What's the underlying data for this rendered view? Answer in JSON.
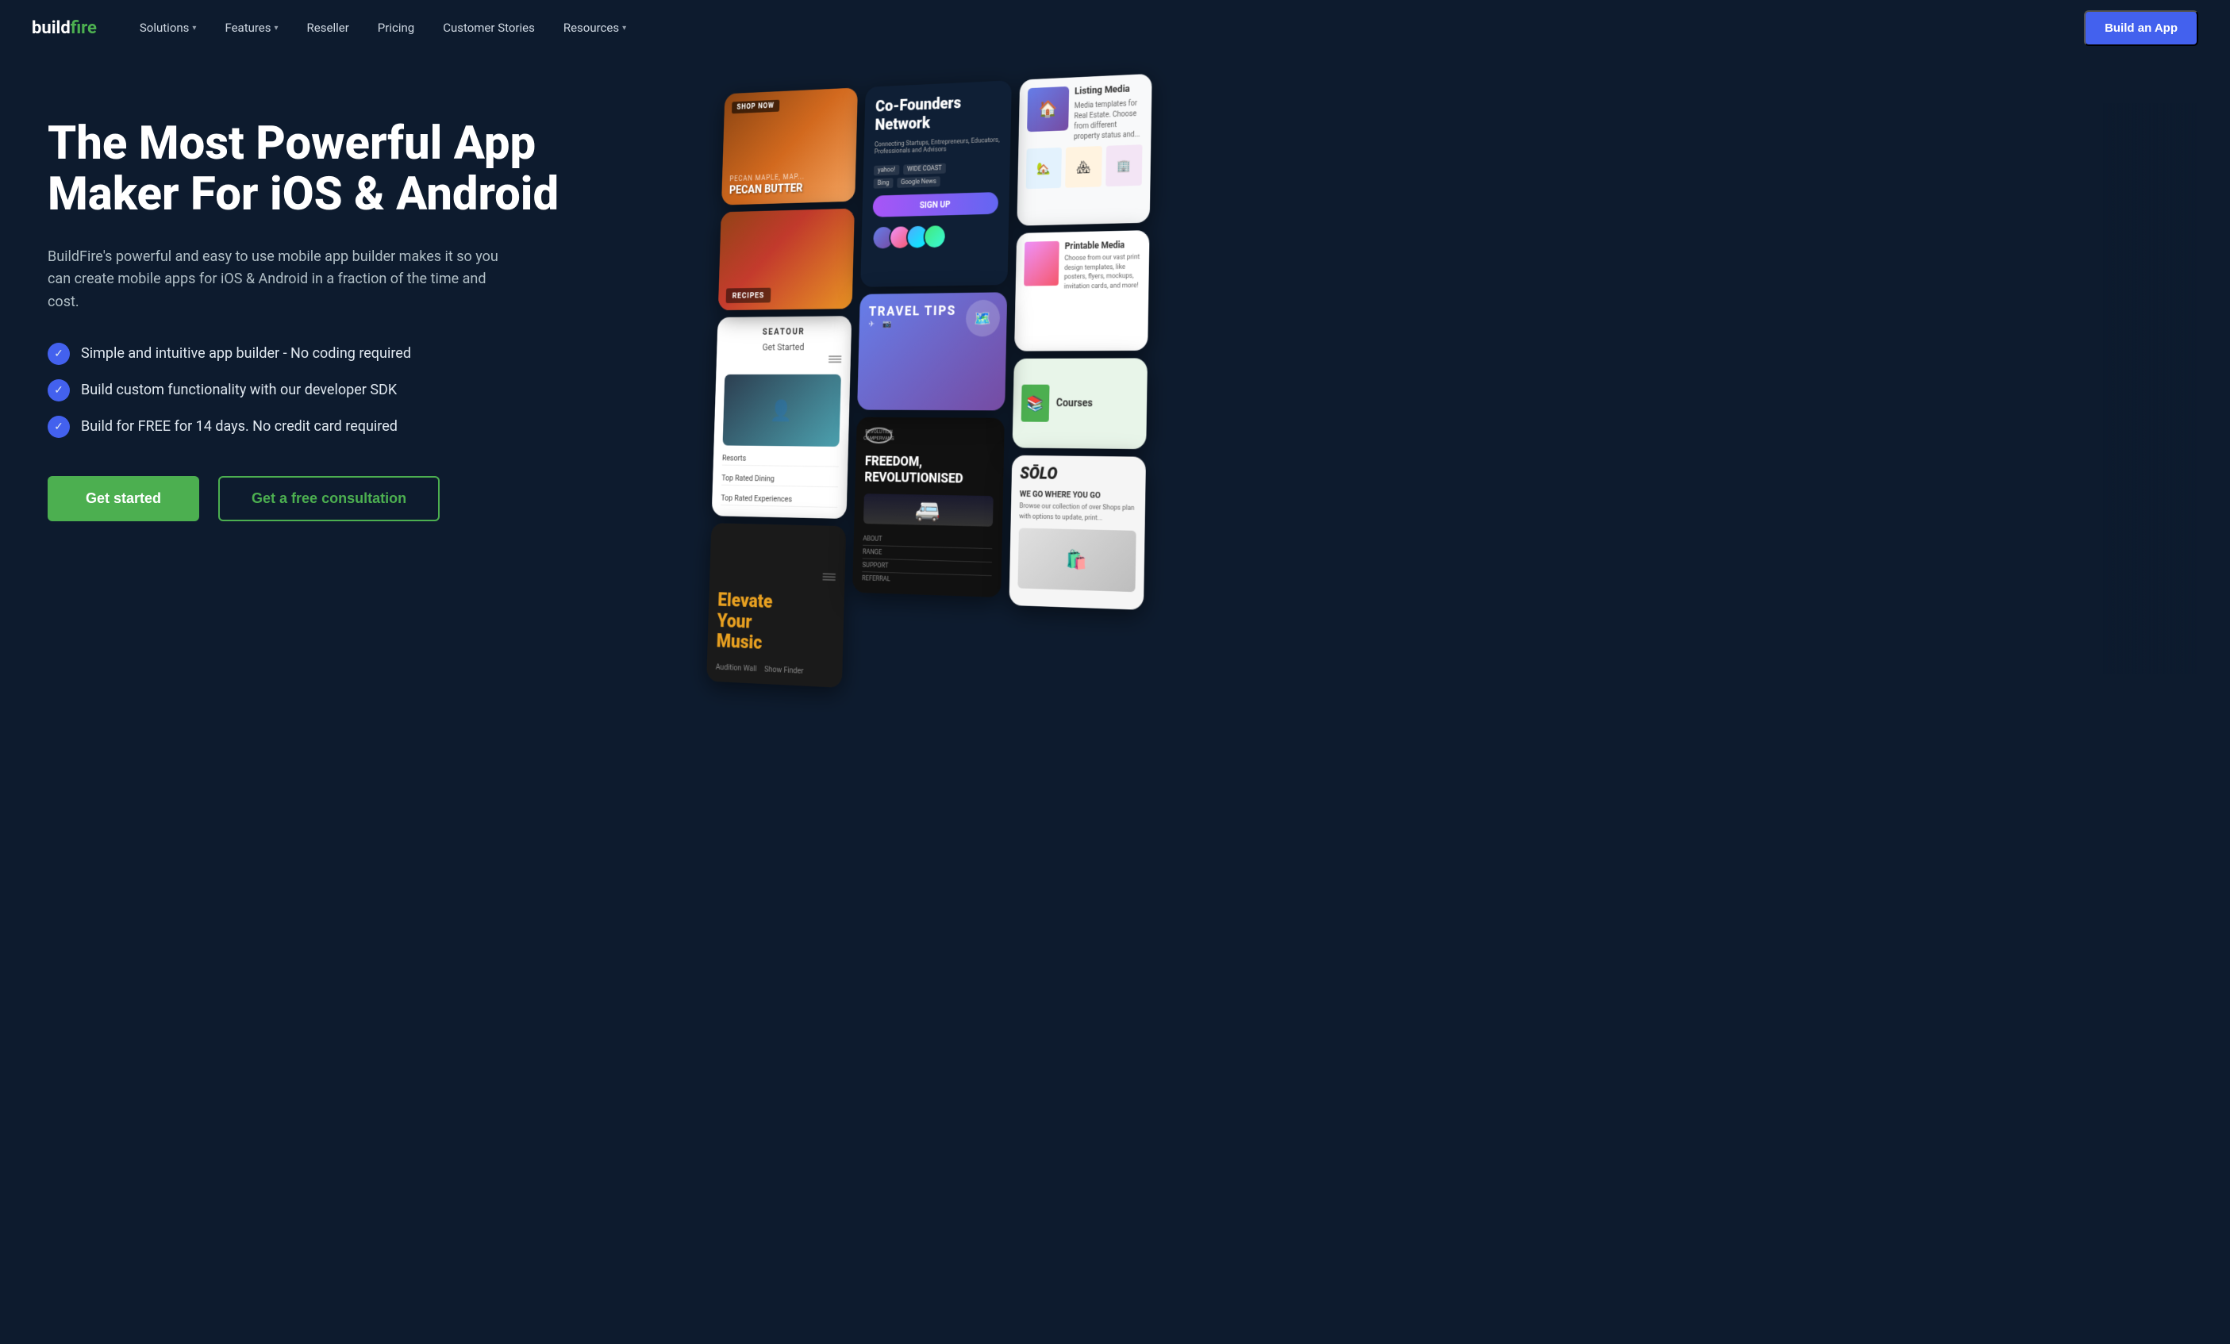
{
  "nav": {
    "logo_text": "buildfire",
    "items": [
      {
        "label": "Solutions",
        "has_dropdown": true
      },
      {
        "label": "Features",
        "has_dropdown": true
      },
      {
        "label": "Reseller",
        "has_dropdown": false
      },
      {
        "label": "Pricing",
        "has_dropdown": false
      },
      {
        "label": "Customer Stories",
        "has_dropdown": false
      },
      {
        "label": "Resources",
        "has_dropdown": true
      }
    ],
    "cta_label": "Build an App"
  },
  "hero": {
    "title": "The Most Powerful App Maker For iOS & Android",
    "subtitle": "BuildFire's powerful and easy to use mobile app builder makes it so you can create mobile apps for iOS & Android in a fraction of the time and cost.",
    "checklist": [
      "Simple and intuitive app builder - No coding required",
      "Build custom functionality with our developer SDK",
      "Build for FREE for 14 days. No credit card required"
    ],
    "btn_primary": "Get started",
    "btn_outline": "Get a free consultation"
  },
  "phones": {
    "col1": {
      "card1_label": "SHOP NOW",
      "card1_product": "PECAN BUTTER",
      "card2_label": "RECIPES",
      "seatour_brand": "SEATOUR",
      "seatour_cta": "Get Started",
      "seatour_resorts": "Resorts",
      "seatour_dining": "Top Rated Dining",
      "seatour_experiences": "Top Rated Experiences",
      "music_line1": "Elevate",
      "music_line2": "Your",
      "music_line3": "Music",
      "music_sub1": "Audition Wall",
      "music_sub2": "Show Finder"
    },
    "col2": {
      "cf_title": "Co-Founders Network",
      "cf_sub": "Connecting Startups, Entrepreneurs, Educators, Professionals and Advisors",
      "signup_label": "SIGN UP",
      "travel_title": "TRAVEL TIPS",
      "rev_badge": "REVOLUTION CAMPERVANS",
      "rev_title": "FREEDOM, REVOLUTIONISED",
      "rev_about": "ABOUT",
      "rev_range": "RANGE",
      "rev_support": "SUPPORT",
      "rev_referral": "REFERRAL"
    },
    "col3": {
      "listing_title": "Listing Media",
      "listing_sub": "Media templates for Real Estate. Choose from different property status and...",
      "printable_title": "Printable Media",
      "printable_sub": "Choose from our vast print design templates, like posters, flyers, mockups, invitation cards, and more!",
      "courses_label": "Courses",
      "solo_brand": "SŌLO",
      "solo_sub": "Browse our collection of over Shops plan with options to update, print...",
      "solo_go": "WE GO WHERE YOU GO"
    }
  }
}
